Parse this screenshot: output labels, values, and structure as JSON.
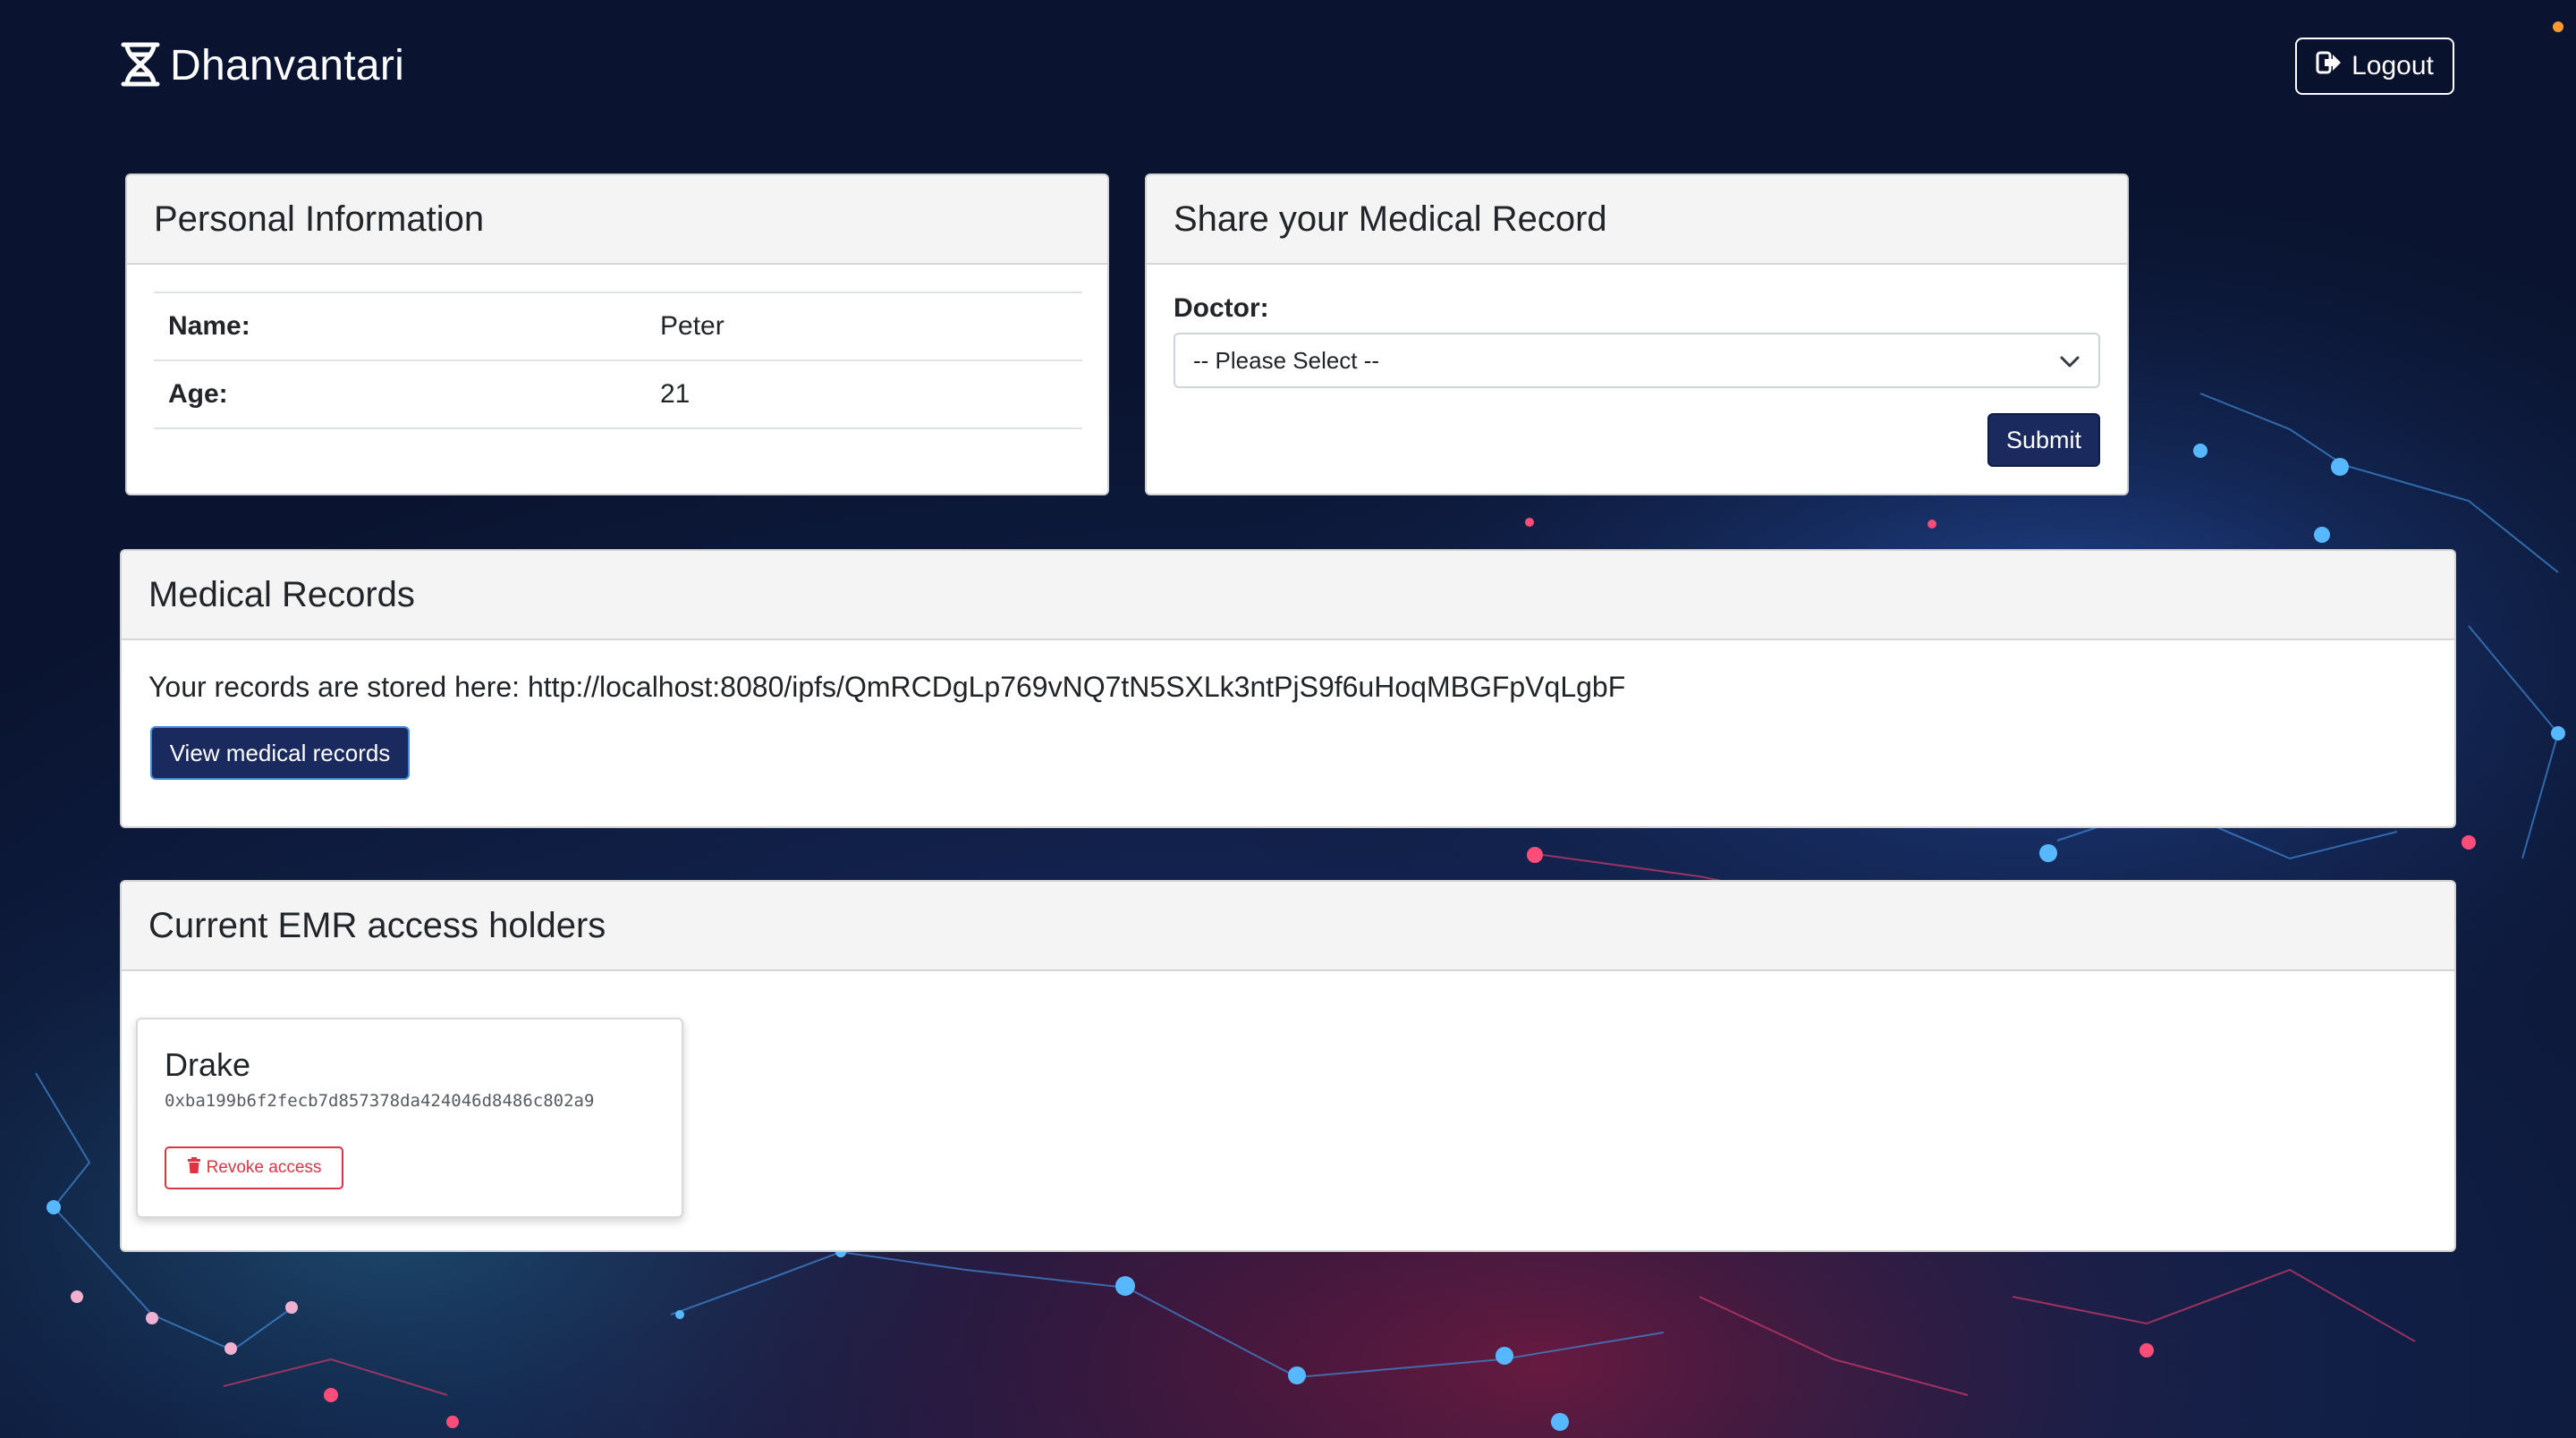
{
  "navbar": {
    "brand": "Dhanvantari",
    "logout_label": "Logout"
  },
  "personal_info": {
    "title": "Personal Information",
    "rows": [
      {
        "label": "Name:",
        "value": "Peter"
      },
      {
        "label": "Age:",
        "value": "21"
      }
    ]
  },
  "share": {
    "title": "Share your Medical Record",
    "doctor_label": "Doctor:",
    "select_value": "-- Please Select --",
    "submit_label": "Submit"
  },
  "records": {
    "title": "Medical Records",
    "text": "Your records are stored here: http://localhost:8080/ipfs/QmRCDgLp769vNQ7tN5SXLk3ntPjS9f6uHoqMBGFpVqLgbF",
    "view_label": "View medical records"
  },
  "access": {
    "title": "Current EMR access holders",
    "holders": [
      {
        "name": "Drake",
        "address": "0xba199b6f2fecb7d857378da424046d8486c802a9",
        "revoke_label": "Revoke access"
      }
    ]
  },
  "colors": {
    "primary_button": "#1b2a5e",
    "danger": "#dc3545",
    "background": "#0b1633"
  }
}
